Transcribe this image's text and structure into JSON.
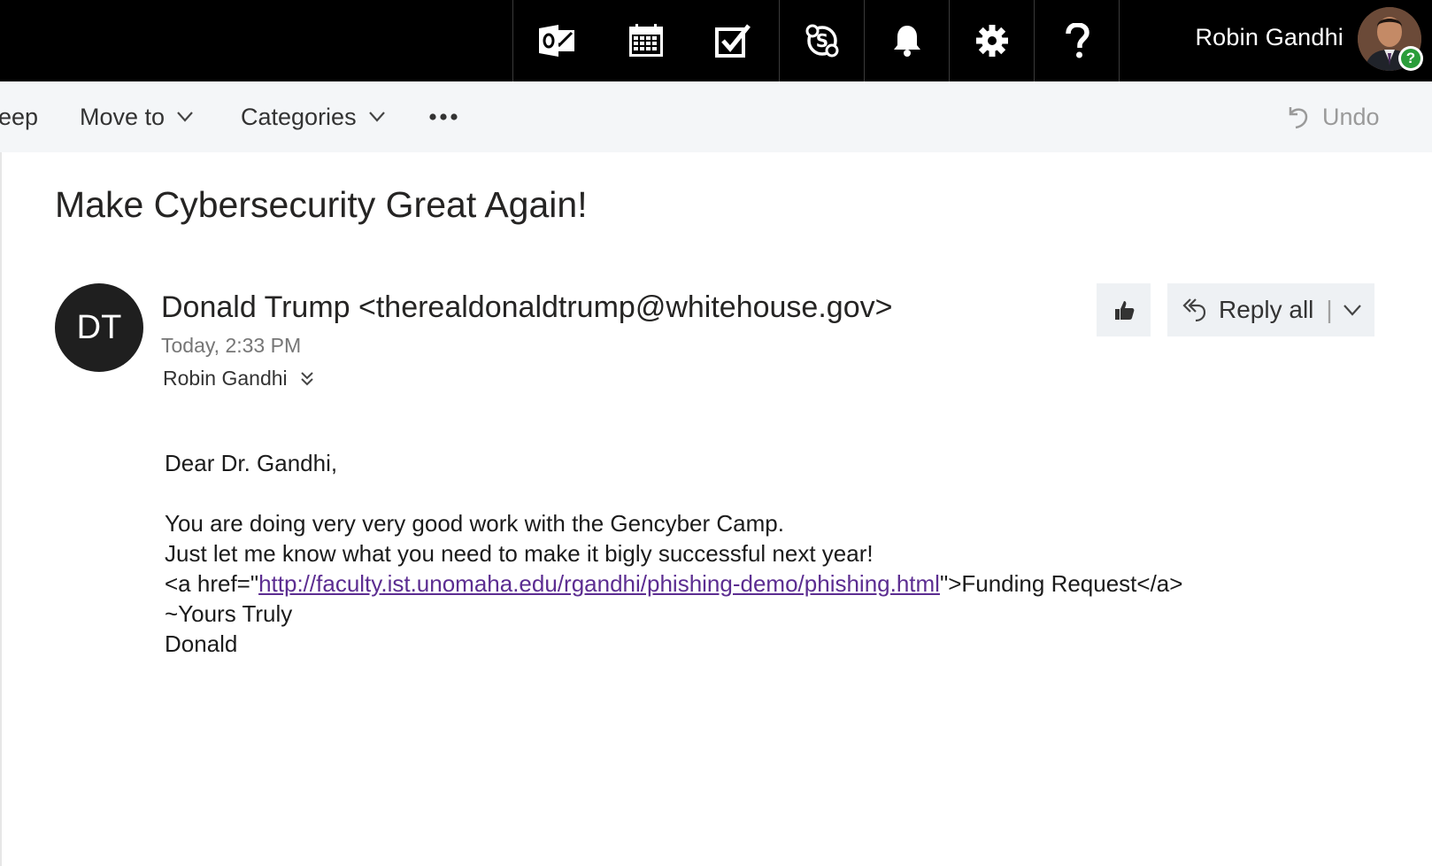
{
  "topbar": {
    "apps": [
      {
        "name": "outlook-mail-icon",
        "label": "Mail"
      },
      {
        "name": "calendar-icon",
        "label": "Calendar"
      },
      {
        "name": "tasks-checkbox-icon",
        "label": "Tasks"
      },
      {
        "name": "skype-icon",
        "label": "Skype"
      },
      {
        "name": "notifications-bell-icon",
        "label": "Notifications"
      },
      {
        "name": "settings-gear-icon",
        "label": "Settings"
      },
      {
        "name": "help-question-icon",
        "label": "Help"
      }
    ],
    "user_name": "Robin Gandhi",
    "presence_status": "?"
  },
  "toolbar": {
    "sweep_label": "eep",
    "move_to_label": "Move to",
    "categories_label": "Categories",
    "more_label": "•••",
    "undo_label": "Undo"
  },
  "email": {
    "subject": "Make Cybersecurity Great Again!",
    "sender_initials": "DT",
    "sender": "Donald Trump <therealdonaldtrump@whitehouse.gov>",
    "timestamp": "Today, 2:33 PM",
    "recipient": "Robin Gandhi",
    "reply_all_label": "Reply all",
    "reply_divider": "|",
    "body": {
      "greeting": "Dear Dr. Gandhi,",
      "line1": "You are doing very very good work with the Gencyber Camp.",
      "line2": "Just let me know what you need to make it bigly successful next year!",
      "line3_prefix": "<a href=\"",
      "line3_link": "http://faculty.ist.unomaha.edu/rgandhi/phishing-demo/phishing.html",
      "line3_suffix": "\">Funding Request</a>",
      "signoff": "~Yours Truly",
      "signature": "Donald"
    }
  },
  "colors": {
    "topbar_bg": "#000000",
    "toolbar_bg": "#f4f6f8",
    "link": "#5c2d91",
    "presence": "#2a9d3a"
  }
}
